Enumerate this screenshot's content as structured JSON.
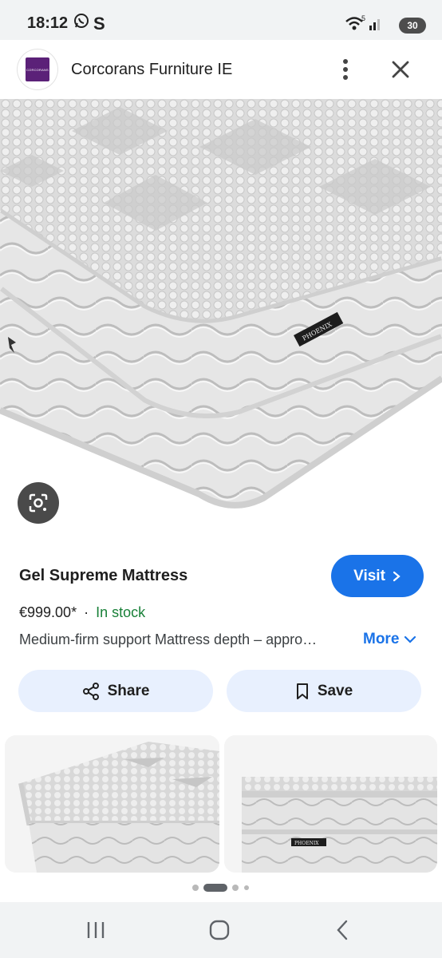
{
  "status_bar": {
    "time": "18:12",
    "icons": [
      "whatsapp-icon",
      "s-app-icon",
      "wifi-icon",
      "signal-icon"
    ],
    "wifi_badge": "5",
    "battery": "30"
  },
  "header": {
    "logo_text": "CORCORANS",
    "site_name": "Corcorans Furniture IE",
    "menu_icon": "more-vert-icon",
    "close_icon": "close-icon"
  },
  "hero": {
    "label_text": "PHOENIX"
  },
  "product": {
    "title": "Gel Supreme Mattress",
    "visit_label": "Visit",
    "price": "€999.00*",
    "separator": "·",
    "stock": "In stock",
    "description": "Medium-firm support Mattress depth – appro…",
    "more_label": "More"
  },
  "actions": {
    "share_label": "Share",
    "save_label": "Save"
  },
  "carousel": {
    "dots_total": 4,
    "active_index": 1,
    "thumb2_label": "PHOENIX"
  },
  "colors": {
    "accent": "#1a73e8",
    "stock_green": "#188038",
    "chip_bg": "#e8f0fe",
    "brand_purple": "#5b2178"
  }
}
